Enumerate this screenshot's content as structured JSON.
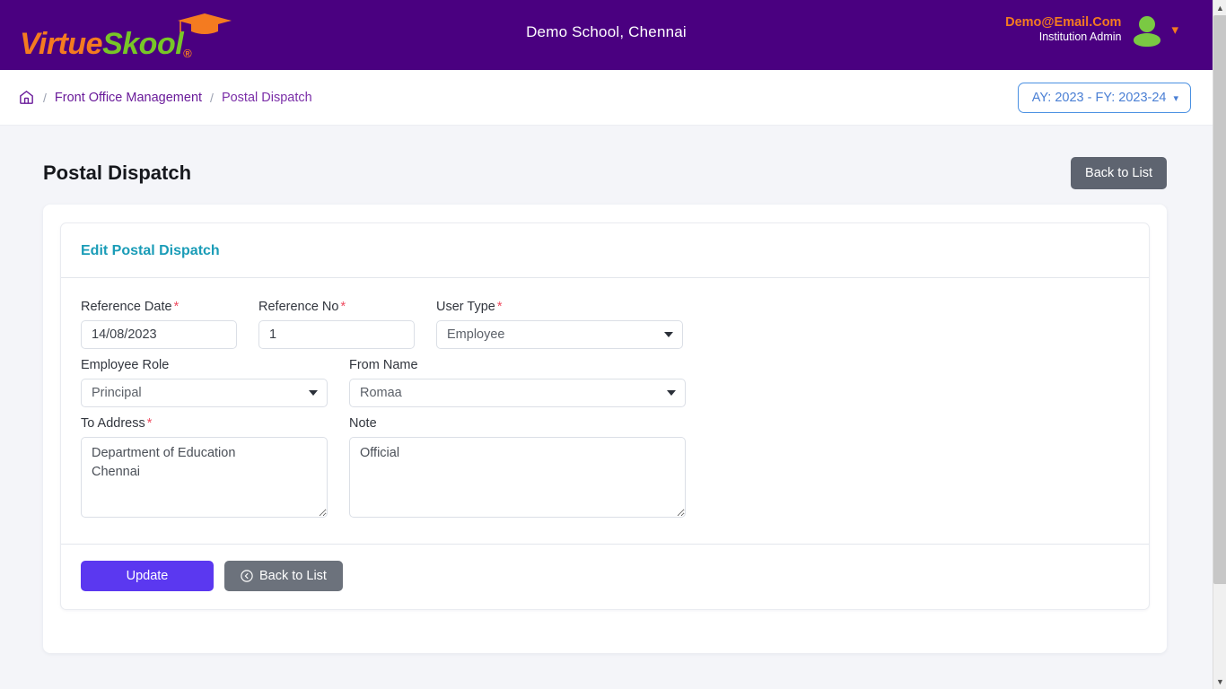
{
  "brand": {
    "word_one": "Virtue",
    "word_two": "Skool",
    "registered_mark": "®",
    "cap_icon": "graduation-cap-icon"
  },
  "header": {
    "school_name": "Demo School, Chennai",
    "user_email": "Demo@Email.Com",
    "user_role": "Institution Admin",
    "avatar_icon": "user-avatar-icon",
    "chevron_icon": "chevron-down-icon",
    "colors": {
      "bar": "#4a0080",
      "email": "#f47b20",
      "avatar": "#7ac943"
    }
  },
  "breadcrumb": {
    "home_icon": "home-icon",
    "separator": "/",
    "items": [
      {
        "label": "Front Office Management"
      },
      {
        "label": "Postal Dispatch"
      }
    ]
  },
  "academic_year": {
    "label": "AY: 2023 - FY: 2023-24",
    "caret_icon": "chevron-down-icon",
    "accent": "#4a90e2"
  },
  "page": {
    "title": "Postal Dispatch",
    "back_button": "Back to List"
  },
  "card": {
    "title": "Edit Postal Dispatch",
    "title_color": "#1a9cb7"
  },
  "form": {
    "reference_date": {
      "label": "Reference Date",
      "required": "*",
      "value": "14/08/2023",
      "placeholder": "Reference Date"
    },
    "reference_no": {
      "label": "Reference No",
      "required": "*",
      "value": "1",
      "placeholder": "Reference No"
    },
    "user_type": {
      "label": "User Type",
      "required": "*",
      "value": "Employee"
    },
    "employee_role": {
      "label": "Employee Role",
      "value": "Principal"
    },
    "from_name": {
      "label": "From Name",
      "value": "Romaa"
    },
    "to_address": {
      "label": "To Address",
      "required": "*",
      "value": "Department of Education\nChennai",
      "placeholder": "To Address"
    },
    "note": {
      "label": "Note",
      "value": "Official",
      "placeholder": "Note"
    }
  },
  "footer": {
    "update_label": "Update",
    "back_label": "Back to List",
    "back_icon": "circle-arrow-left-icon",
    "update_color": "#5b38f0",
    "back_color": "#6c727c"
  },
  "scrollbar": {
    "up_icon": "chevron-up-icon",
    "down_icon": "chevron-down-icon"
  }
}
